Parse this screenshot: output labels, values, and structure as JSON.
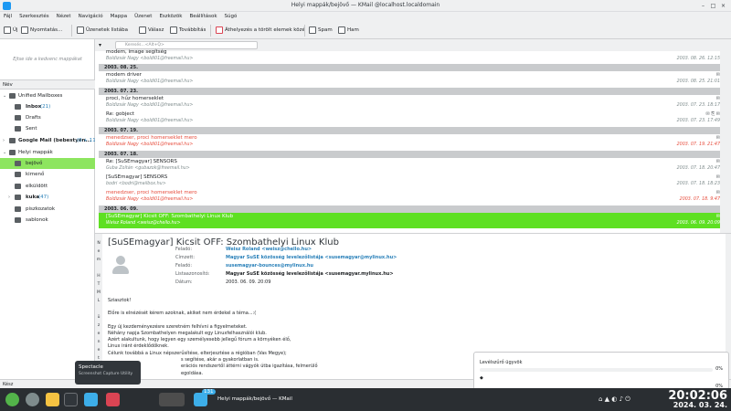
{
  "window": {
    "title": "Helyi mappák/bejövő — KMail @localhost.localdomain"
  },
  "menu": [
    "Fájl",
    "Szerkesztés",
    "Nézet",
    "Navigáció",
    "Mappa",
    "Üzenet",
    "Eszközök",
    "Beállítások",
    "Súgó"
  ],
  "toolbar": {
    "new": "Új",
    "print": "Nyomtatás...",
    "list": "Üzenetek listába",
    "reply": "Válasz",
    "forward": "Továbbítás",
    "trash": "Áthelyezés a törölt elemek közé",
    "spam": "Spam",
    "ham": "Ham"
  },
  "sidebar": {
    "favorites_placeholder": "Ejtse ide a kedvenc mappákat",
    "header": "Név",
    "items": [
      {
        "label": "Unified Mailboxes",
        "count": ""
      },
      {
        "label": "Inbox",
        "count": "(21)"
      },
      {
        "label": "Drafts",
        "count": ""
      },
      {
        "label": "Sent",
        "count": ""
      },
      {
        "label": "Google Mail (bebestyen...",
        "count": "(0 + 110"
      },
      {
        "label": "Helyi mappák",
        "count": ""
      },
      {
        "label": "bejövő",
        "count": ""
      },
      {
        "label": "kimenő",
        "count": ""
      },
      {
        "label": "elküldött",
        "count": ""
      },
      {
        "label": "kuka",
        "count": "(47)"
      },
      {
        "label": "piszkozatok",
        "count": ""
      },
      {
        "label": "sablonok",
        "count": ""
      }
    ]
  },
  "search": {
    "placeholder": "Keresés...<Alt+Q>"
  },
  "messages": {
    "top": {
      "subject": "modem, image segítség",
      "from": "Boldizsár Nagy <boldi01@freemail.hu>",
      "date": "2003. 08. 26. 12:15"
    },
    "groups": [
      {
        "label": "2003. 08. 25.",
        "items": [
          {
            "subject": "modem driver",
            "from": "Boldizsár Nagy <boldi01@freemail.hu>",
            "date": "2003. 08. 25. 21:01",
            "style": "normal"
          }
        ]
      },
      {
        "label": "2003. 07. 23.",
        "items": [
          {
            "subject": "proci, hűz homerseklet",
            "from": "Boldizsár Nagy <boldi01@freemail.hu>",
            "date": "2003. 07. 23. 18:17",
            "style": "normal"
          },
          {
            "subject": "Re: gobject",
            "from": "Boldizsár Nagy <boldi01@freemail.hu>",
            "date": "2003. 07. 23. 17:49",
            "style": "normal"
          }
        ]
      },
      {
        "label": "2003. 07. 19.",
        "items": [
          {
            "subject": "menedzser, proci homerseklet mero",
            "from": "Boldizsár Nagy <boldi01@freemail.hu>",
            "date": "2003. 07. 19. 21:47",
            "style": "red"
          }
        ]
      },
      {
        "label": "2003. 07. 18.",
        "items": [
          {
            "subject": "Re: [SuSEmagyar] SENSORS",
            "from": "Guba Zoltán <gubazok@freemail.hu>",
            "date": "2003. 07. 18. 20:47",
            "style": "normal"
          },
          {
            "subject": "[SuSEmagyar] SENSORS",
            "from": "bodri <bodri@mailbox.hu>",
            "date": "2003. 07. 18. 18:23",
            "style": "normal"
          },
          {
            "subject": "menedzser, proci homerseklet mero",
            "from": "Boldizsár Nagy <boldi01@freemail.hu>",
            "date": "2003. 07. 18. 9:47",
            "style": "red"
          }
        ]
      },
      {
        "label": "2003. 06. 09.",
        "items": [
          {
            "subject": "[SuSEmagyar] Kicsit OFF: Szombathelyi Linux Klub",
            "from": "Weisz Roland <weisz@chello.hu>",
            "date": "2003. 06. 09. 20:09",
            "style": "sel"
          }
        ]
      }
    ]
  },
  "reader": {
    "side_label": [
      "N",
      "e",
      "m",
      "",
      "H",
      "T",
      "M",
      "L",
      "",
      "ü",
      "z",
      "e",
      "n",
      "e",
      "t"
    ],
    "title": "[SuSEmagyar] Kicsit OFF: Szombathelyi Linux Klub",
    "headers": [
      {
        "key": "Feladó:",
        "value": "Weisz Roland <weisz@chello.hu>",
        "link": true
      },
      {
        "key": "Címzett:",
        "value": "Magyar SuSE közösség levelezőlistája <susemagyar@mylinux.hu>",
        "link": true
      },
      {
        "key": "Feladó:",
        "value": "susemagyar-bounces@mylinux.hu",
        "link": true
      },
      {
        "key": "Listaazonosító:",
        "value": "Magyar SuSE közösség levelezőlistája <susemagyar.mylinux.hu>",
        "link": false
      },
      {
        "key": "Dátum:",
        "value": "2003. 06. 09. 20:09",
        "link": false
      }
    ],
    "body": [
      "Sziasztok!",
      "",
      "Előre is elnézését kérem azoknak, akiket nem érdekel a téma...:(",
      "",
      "Egy új kezdeményezésre szeretném felhívni a figyelmeteket.",
      "Néhány napja Szombathelyen megalakult egy Linuxfelhasználói klub.",
      "Azért alakultunk, hogy legyen egy személyesebb jellegű fórum a környéken élő,",
      "Linux iránt érdeklődőknek.",
      "Célunk továbbá a Linux népszerűsítése, elterjesztése a régióban (Vas Megye);",
      "s segítése, akár a gyakorlatban is.",
      "erációs rendszertől áttérni vágyók útba igazítása, felmerülő",
      "egoldása."
    ]
  },
  "status": {
    "text": "Kész"
  },
  "filter_panel": {
    "title": "Levélszűrő ügyvök",
    "percent_a": "0%",
    "percent_b": "0%"
  },
  "tooltip": {
    "title": "Spectacle",
    "subtitle": "Screenshot Capture Utility"
  },
  "taskbar": {
    "badge": "131",
    "task_label": "Helyi mappák/bejövő — KMail",
    "time": "20:02:06",
    "date": "2024. 03. 24."
  },
  "colors": {
    "accent": "#8de55f",
    "selection": "#5ee022",
    "link": "#2980b9",
    "unread_red": "#e74c3c"
  }
}
